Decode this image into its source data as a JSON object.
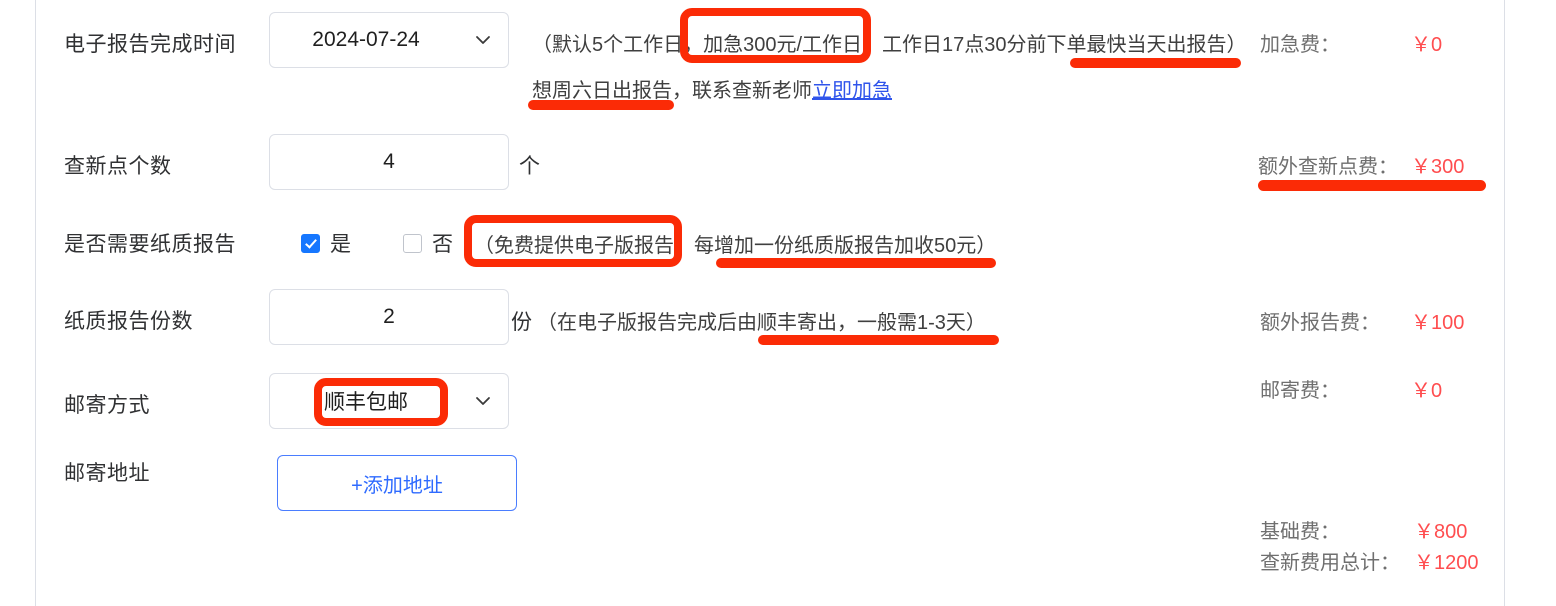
{
  "form": {
    "rows": [
      {
        "label": "电子报告完成时间",
        "control": "select",
        "value": "2024-07-24",
        "hint_line1": "（默认5个工作日，加急300元/工作日，工作日17点30分前下单最快当天出报告）",
        "hint_line2_prefix": "想周六日出报告，联系查新老师",
        "hint_line2_link": "立即加急"
      },
      {
        "label": "查新点个数",
        "control": "number",
        "value": "4",
        "unit": "个"
      },
      {
        "label": "是否需要纸质报告",
        "control": "checkbox",
        "option_yes": "是",
        "option_no": "否",
        "yes_checked": true,
        "no_checked": false,
        "hint": "（免费提供电子版报告，每增加一份纸质版报告加收50元）"
      },
      {
        "label": "纸质报告份数",
        "control": "number",
        "value": "2",
        "unit": "份",
        "hint": "（在电子版报告完成后由顺丰寄出，一般需1-3天）"
      },
      {
        "label": "邮寄方式",
        "control": "select",
        "value": "顺丰包邮"
      },
      {
        "label": "邮寄地址",
        "control": "button",
        "button_label": "+添加地址"
      }
    ]
  },
  "prices": {
    "rush_fee_label": "加急费：",
    "rush_fee_value": "￥0",
    "extra_point_label": "额外查新点费：",
    "extra_point_value": "￥300",
    "extra_report_label": "额外报告费：",
    "extra_report_value": "￥100",
    "shipping_label": "邮寄费：",
    "shipping_value": "￥0",
    "base_label": "基础费：",
    "base_value": "￥800",
    "total_label": "查新费用总计：",
    "total_value": "￥1200"
  },
  "icons": {
    "chevron_down": "chevron-down-icon",
    "checkbox_checked": "checkbox-checked-icon",
    "checkbox_unchecked": "checkbox-unchecked-icon"
  },
  "colors": {
    "annotation_red": "#fb2b06",
    "price_red": "#ff4d4f",
    "link_blue": "#2f54eb",
    "checkbox_blue": "#1677ff",
    "button_blue": "#2f6bff",
    "border_grey": "#dcdfe6"
  },
  "annotations": {
    "box_rush_price": "加急300元/工作日，",
    "box_free_ereport": "（免费提供电子版报告",
    "box_shipping_method": "顺丰包邮",
    "underline_same_day": "工作日17点30分前下单最快当天出报告",
    "underline_weekend": "想周六日出报告",
    "underline_extra_point_fee": "额外查新点费：￥300",
    "underline_extra_paper_fee": "每增加一份纸质版报告加收50元",
    "underline_sf_days": "一般需1-3天"
  }
}
